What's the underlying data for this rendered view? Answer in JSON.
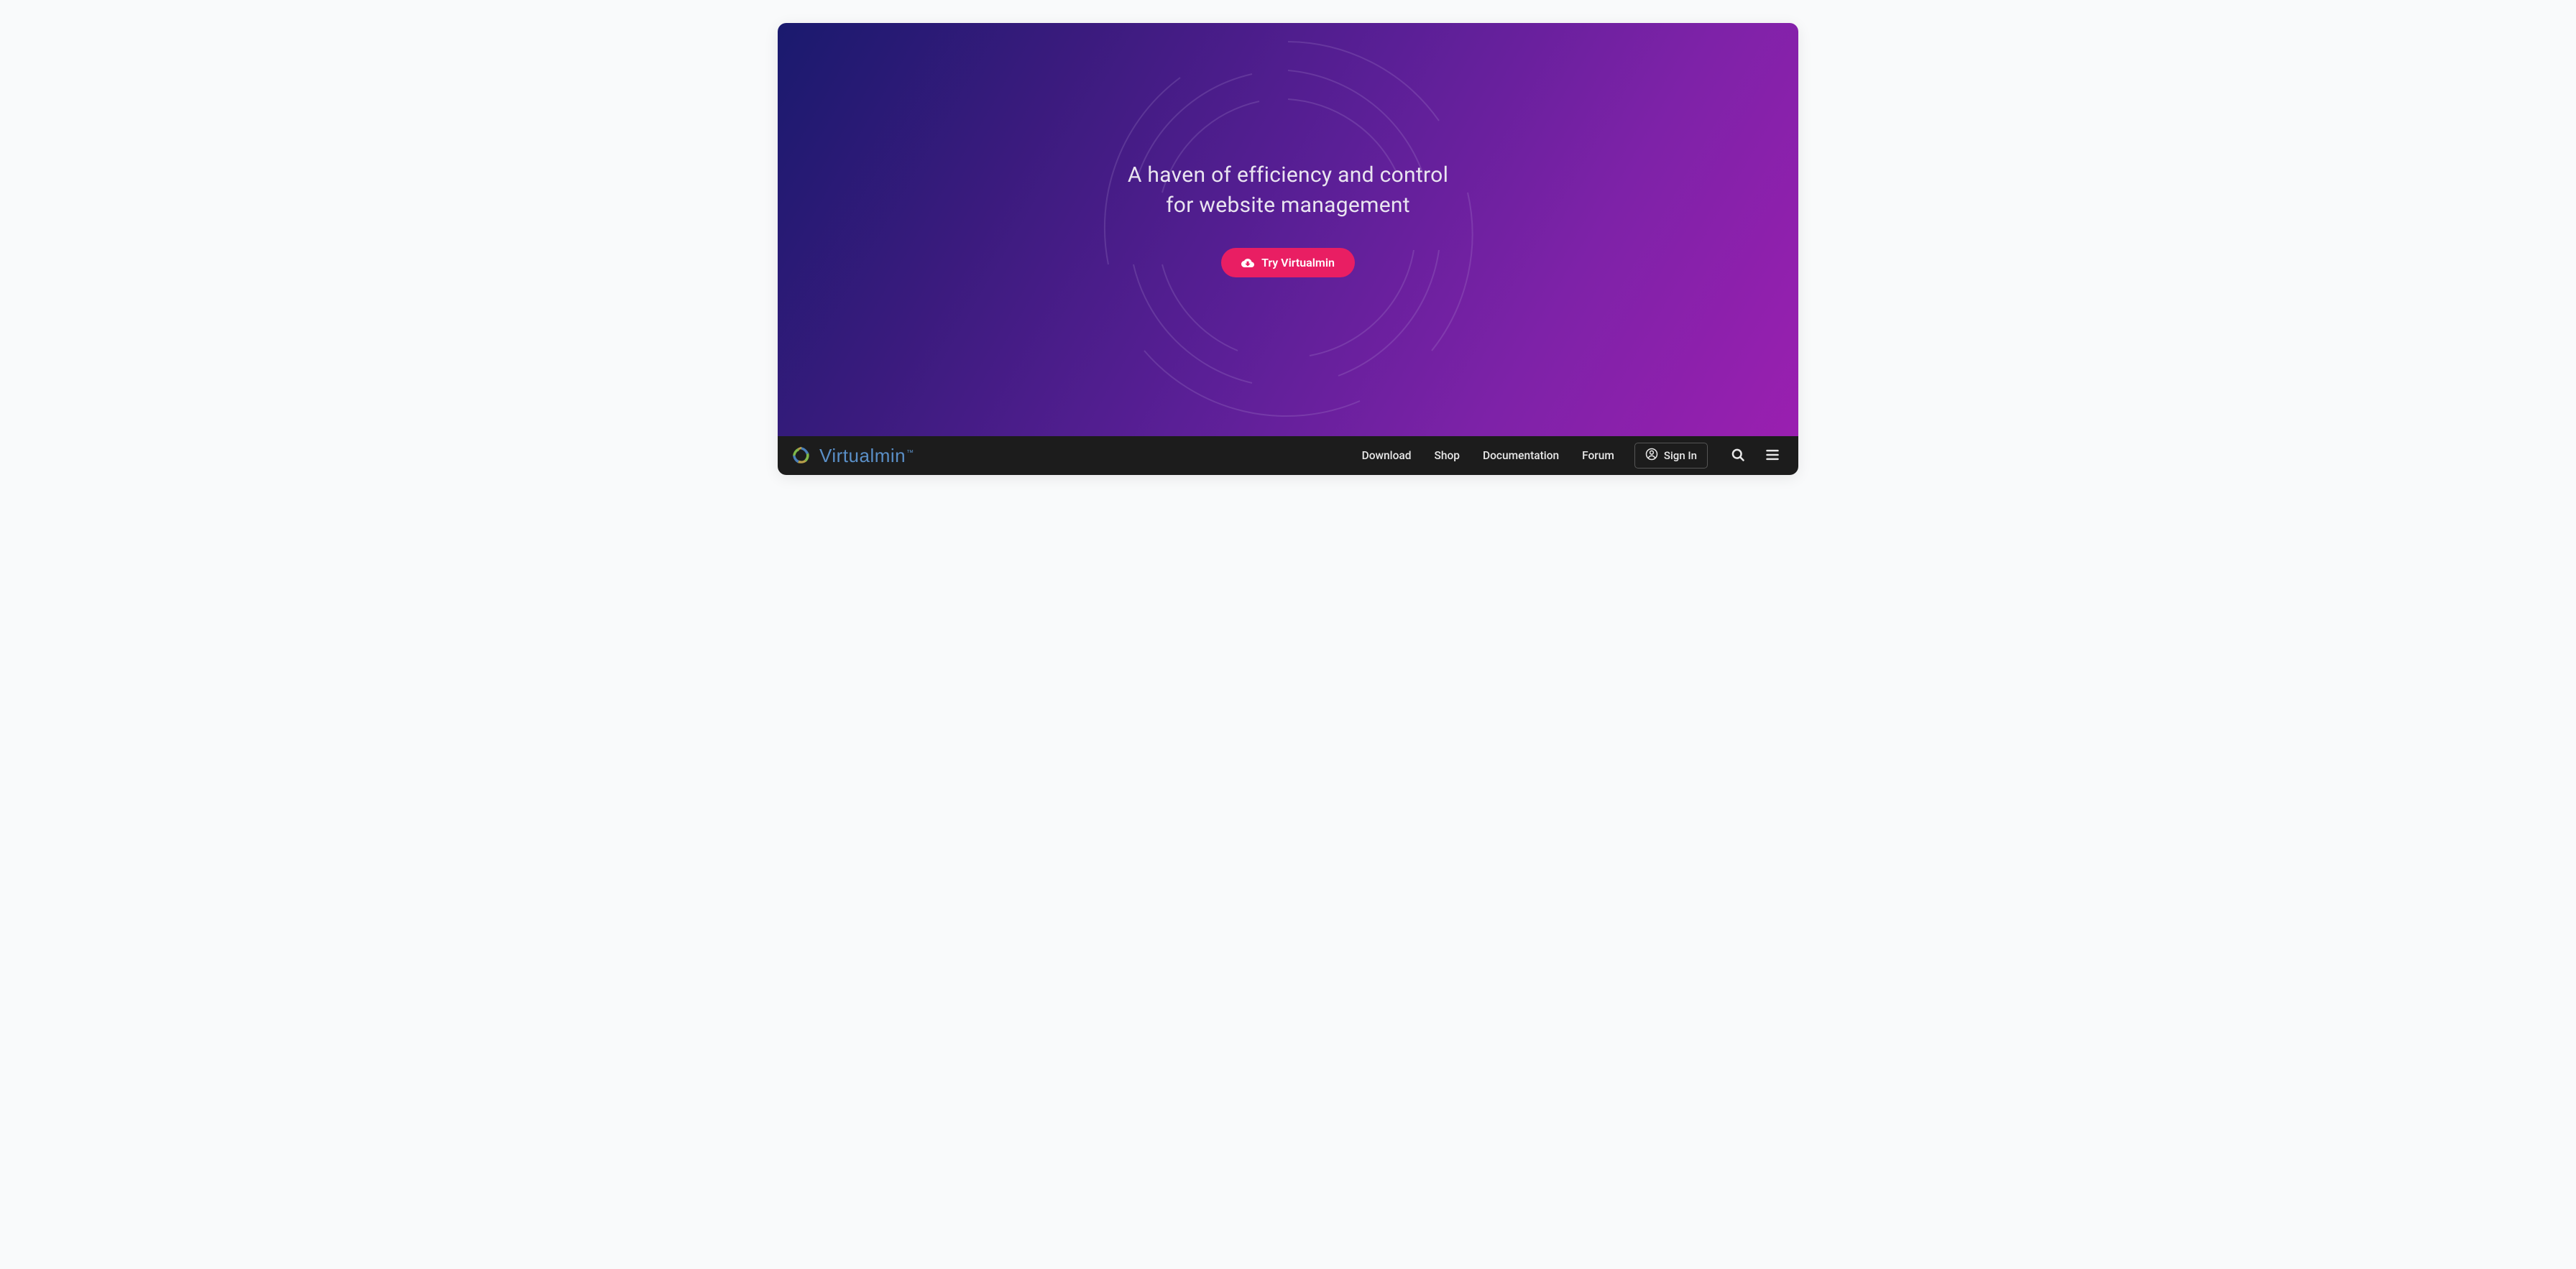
{
  "hero": {
    "headline_line1": "A haven of efficiency and control",
    "headline_line2": "for website management",
    "cta_label": "Try Virtualmin"
  },
  "brand": {
    "name": "Virtualmin"
  },
  "nav": {
    "links": [
      {
        "label": "Download"
      },
      {
        "label": "Shop"
      },
      {
        "label": "Documentation"
      },
      {
        "label": "Forum"
      }
    ],
    "signin_label": "Sign In"
  },
  "colors": {
    "accent": "#e91e63",
    "brand_text": "#5a8fc7",
    "navbar_bg": "#1c1c1c"
  }
}
